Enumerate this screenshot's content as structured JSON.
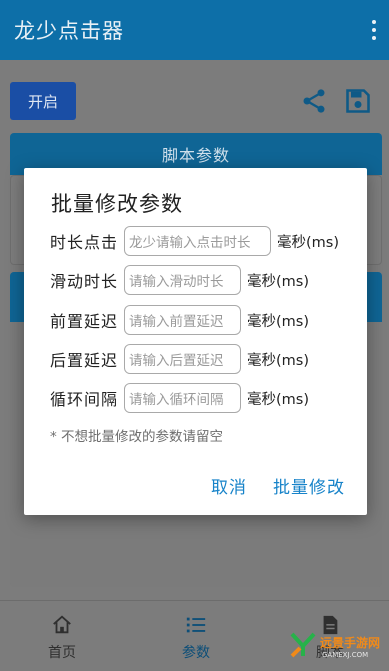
{
  "app": {
    "title": "龙少点击器"
  },
  "toolbar": {
    "start_label": "开启"
  },
  "script_params_card": {
    "title": "脚本参数"
  },
  "bottom_nav": [
    {
      "label": "首页",
      "icon": "home-icon"
    },
    {
      "label": "参数",
      "icon": "list-icon",
      "active": true
    },
    {
      "label": "脚本",
      "icon": "document-icon"
    }
  ],
  "dialog": {
    "title": "批量修改参数",
    "rows": [
      {
        "label": "时长点击",
        "placeholder": "龙少请输入点击时长",
        "unit": "毫秒(ms)"
      },
      {
        "label": "滑动时长",
        "placeholder": "请输入滑动时长",
        "unit": "毫秒(ms)"
      },
      {
        "label": "前置延迟",
        "placeholder": "请输入前置延迟",
        "unit": "毫秒(ms)"
      },
      {
        "label": "后置延迟",
        "placeholder": "请输入后置延迟",
        "unit": "毫秒(ms)"
      },
      {
        "label": "循环间隔",
        "placeholder": "请输入循环间隔",
        "unit": "毫秒(ms)"
      }
    ],
    "hint": "* 不想批量修改的参数请留空",
    "cancel_label": "取消",
    "confirm_label": "批量修改"
  },
  "watermark": {
    "name": "远景手游网",
    "domain": "GAMEXJ.COM"
  },
  "colors": {
    "primary": "#1976b8",
    "accent": "#1783c9",
    "scrim": "rgba(0,0,0,0.5)"
  }
}
